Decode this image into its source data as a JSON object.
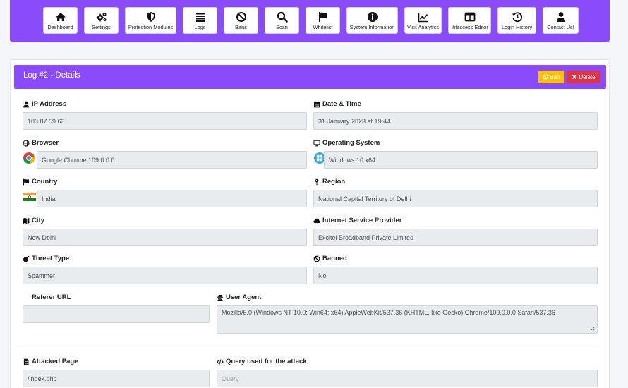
{
  "nav": [
    {
      "label": "Dashboard",
      "icon": "home-icon"
    },
    {
      "label": "Settings",
      "icon": "cogs-icon"
    },
    {
      "label": "Protection Modules",
      "icon": "shield-icon"
    },
    {
      "label": "Logs",
      "icon": "list-icon"
    },
    {
      "label": "Bans",
      "icon": "ban-icon"
    },
    {
      "label": "Scan",
      "icon": "search-icon"
    },
    {
      "label": "Whitelist",
      "icon": "flag-icon"
    },
    {
      "label": "System Information",
      "icon": "info-icon"
    },
    {
      "label": "Visit Analytics",
      "icon": "chart-line-icon"
    },
    {
      "label": ".htaccess Editor",
      "icon": "columns-icon"
    },
    {
      "label": "Login History",
      "icon": "history-icon"
    },
    {
      "label": "Contact Us!",
      "icon": "user-icon"
    }
  ],
  "card": {
    "title": "Log #2 - Details",
    "ban_label": "Ban",
    "delete_label": "Delete"
  },
  "fields": {
    "ip": {
      "label": "IP Address",
      "value": "103.87.59.63"
    },
    "datetime": {
      "label": "Date & Time",
      "value": "31 January 2023 at 19:44"
    },
    "browser": {
      "label": "Browser",
      "value": "Google Chrome 109.0.0.0"
    },
    "os": {
      "label": "Operating System",
      "value": "Windows 10 x64"
    },
    "country": {
      "label": "Country",
      "value": "India"
    },
    "region": {
      "label": "Region",
      "value": "National Capital Territory of Delhi"
    },
    "city": {
      "label": "City",
      "value": "New Delhi"
    },
    "isp": {
      "label": "Internet Service Provider",
      "value": "Excitel Broadband Private Limited"
    },
    "threat": {
      "label": "Threat Type",
      "value": "Spammer"
    },
    "banned": {
      "label": "Banned",
      "value": "No"
    },
    "referer": {
      "label": "Referer URL",
      "value": ""
    },
    "useragent": {
      "label": "User Agent",
      "value": "Mozilla/5.0 (Windows NT 10.0; Win64; x64) AppleWebKit/537.36 (KHTML, like Gecko) Chrome/109.0.0.0 Safari/537.36"
    },
    "page": {
      "label": "Attacked Page",
      "value": "/index.php"
    },
    "query": {
      "label": "Query used for the attack",
      "placeholder": "Query"
    }
  },
  "colors": {
    "accent": "#8a4cfb",
    "warning": "#ffc107",
    "danger": "#dc3545",
    "input_bg": "#e9ecef"
  }
}
